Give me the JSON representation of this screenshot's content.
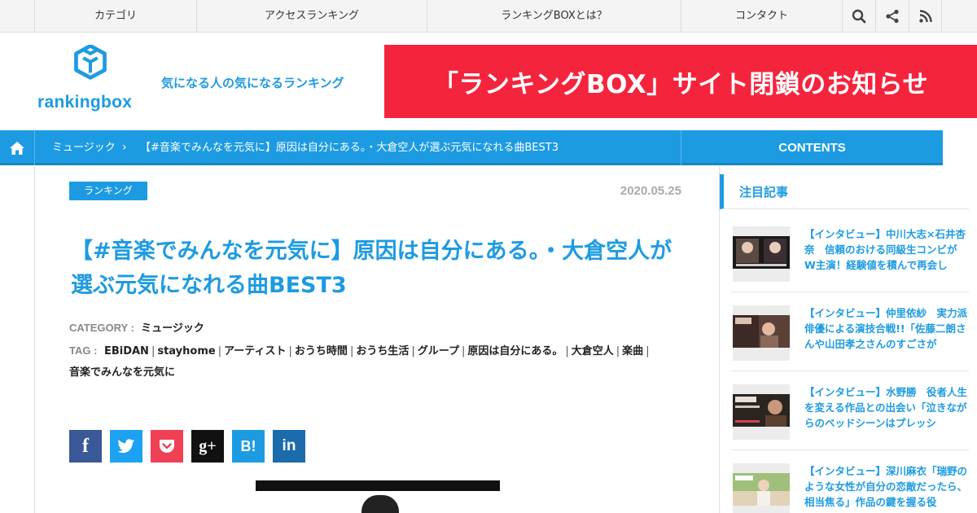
{
  "topnav": {
    "items": [
      "カテゴリ",
      "アクセスランキング",
      "ランキングBOXとは？",
      "コンタクト"
    ],
    "icons": [
      "search-icon",
      "share-icon",
      "rss-icon"
    ]
  },
  "header": {
    "logo_text": "rankingbox",
    "tagline": "気になる人の気になるランキング",
    "banner_text": "「ランキングBOX」サイト閉鎖のお知らせ"
  },
  "breadcrumb": {
    "category": "ミュージック",
    "current": "【#音楽でみんなを元気に】原因は自分にある。・大倉空人が選ぶ元気になれる曲BEST3",
    "separator": "›",
    "contents_label": "CONTENTS"
  },
  "article": {
    "badge": "ランキング",
    "date": "2020.05.25",
    "title": "【#音楽でみんなを元気に】原因は自分にある。・大倉空人が選ぶ元気になれる曲BEST3",
    "category_label": "CATEGORY :",
    "category_value": "ミュージック",
    "tag_label": "TAG :",
    "tags": [
      "EBiDAN",
      "stayhome",
      "アーティスト",
      "おうち時間",
      "おうち生活",
      "グループ",
      "原因は自分にある。",
      "大倉空人",
      "楽曲",
      "音楽でみんなを元気に"
    ],
    "tag_separator": "|",
    "share_buttons": [
      {
        "name": "facebook",
        "glyph": "f",
        "color": "#3b5998"
      },
      {
        "name": "twitter",
        "glyph": "t",
        "color": "#1da1f2"
      },
      {
        "name": "pocket",
        "glyph": "p",
        "color": "#ef4056"
      },
      {
        "name": "google-plus",
        "glyph": "g+",
        "color": "#111111"
      },
      {
        "name": "hatena",
        "glyph": "B!",
        "color": "#1d9be2"
      },
      {
        "name": "linkedin",
        "glyph": "in",
        "color": "#1c6bad"
      }
    ]
  },
  "sidebar": {
    "heading": "注目記事",
    "items": [
      {
        "title": "【インタビュー】中川大志×石井杏奈　信頼のおける同級生コンビがW主演！経験値を積んで再会し"
      },
      {
        "title": "【インタビュー】仲里依紗　実力派俳優による演技合戦!!「佐藤二朗さんや山田孝之さんのすごさが"
      },
      {
        "title": "【インタビュー】水野勝　役者人生を変える作品との出会い「泣きながらのベッドシーンはプレッシ"
      },
      {
        "title": "【インタビュー】深川麻衣「瑞野のような女性が自分の恋敵だったら、相当焦る」作品の鍵を握る役"
      }
    ]
  },
  "colors": {
    "brand_blue": "#1d9be2",
    "banner_red": "#f5243d"
  }
}
